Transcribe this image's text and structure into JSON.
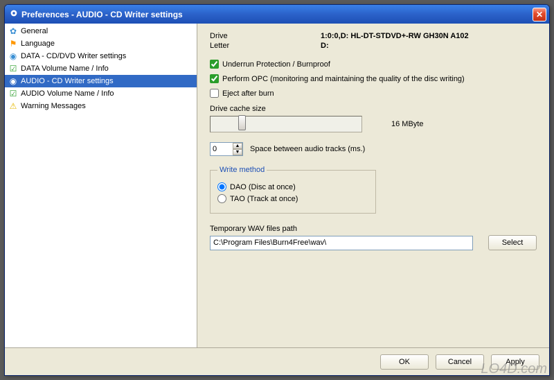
{
  "window": {
    "title": "Preferences - AUDIO - CD Writer settings"
  },
  "sidebar": {
    "items": [
      {
        "label": "General",
        "icon": "gear"
      },
      {
        "label": "Language",
        "icon": "flag"
      },
      {
        "label": "DATA - CD/DVD Writer settings",
        "icon": "disc"
      },
      {
        "label": "DATA Volume Name / Info",
        "icon": "check"
      },
      {
        "label": "AUDIO - CD Writer settings",
        "icon": "disc",
        "selected": true
      },
      {
        "label": "AUDIO Volume Name / Info",
        "icon": "check"
      },
      {
        "label": "Warning Messages",
        "icon": "warn"
      }
    ]
  },
  "drive": {
    "label": "Drive",
    "value": "1:0:0,D: HL-DT-STDVD+-RW GH30N   A102",
    "letter_label": "Letter",
    "letter_value": "D:"
  },
  "checks": {
    "underrun": {
      "label": "Underrun Protection / Burnproof",
      "checked": true
    },
    "opc": {
      "label": "Perform OPC (monitoring and maintaining the quality of the disc writing)",
      "checked": true
    },
    "eject": {
      "label": "Eject after burn",
      "checked": false
    }
  },
  "cache": {
    "label": "Drive cache size",
    "value_text": "16 MByte"
  },
  "spacing": {
    "value": "0",
    "label": "Space between audio tracks (ms.)"
  },
  "write_method": {
    "legend": "Write method",
    "dao": {
      "label": "DAO (Disc at once)",
      "checked": true
    },
    "tao": {
      "label": "TAO (Track at once)",
      "checked": false
    }
  },
  "wav_path": {
    "label": "Temporary WAV files path",
    "value": "C:\\Program Files\\Burn4Free\\wav\\",
    "select_label": "Select"
  },
  "buttons": {
    "ok": "OK",
    "cancel": "Cancel",
    "apply": "Apply"
  },
  "watermark": "LO4D.com"
}
